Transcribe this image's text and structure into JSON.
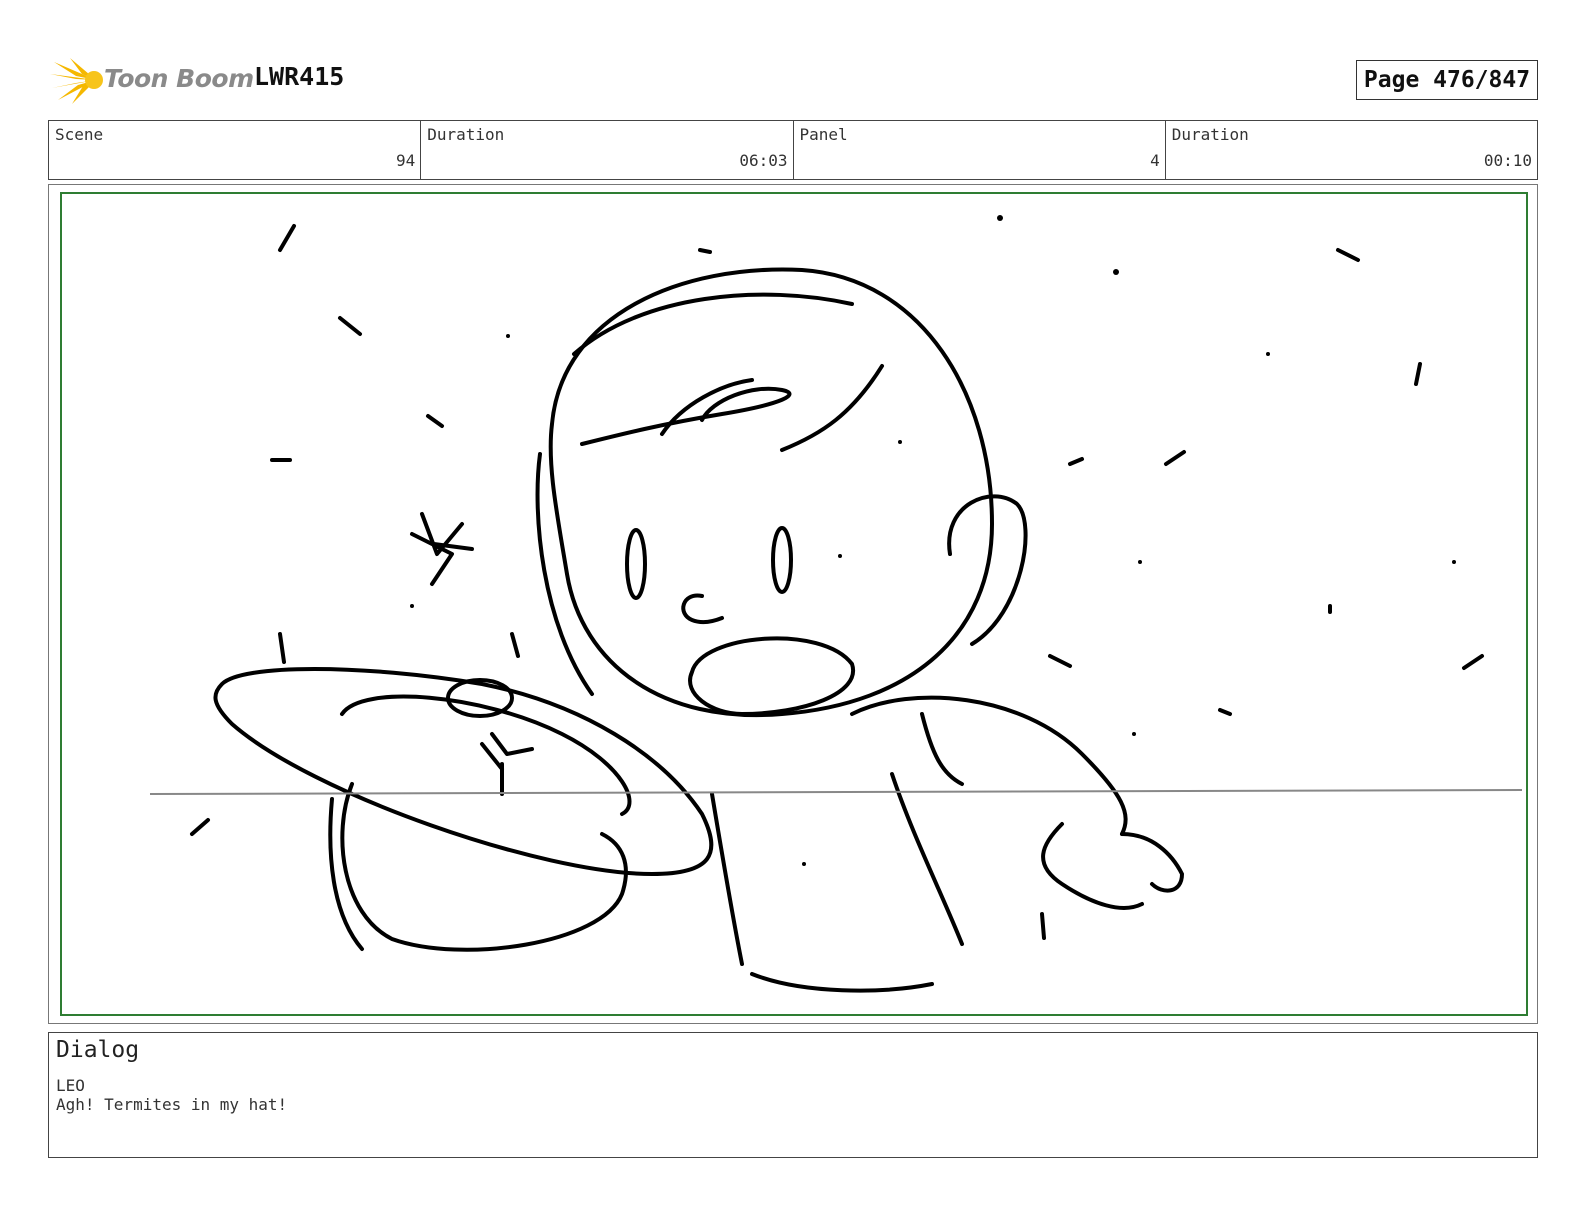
{
  "header": {
    "logo_text": "Toon Boom",
    "project_code": "LWR415",
    "page_label": "Page 476/847"
  },
  "info": [
    {
      "label": "Scene",
      "value": "94"
    },
    {
      "label": "Duration",
      "value": "06:03"
    },
    {
      "label": "Panel",
      "value": "4"
    },
    {
      "label": "Duration",
      "value": "00:10"
    }
  ],
  "panel": {
    "frame_color": "#2e7d32",
    "sketch_subject": "child startled by a flying termite swarm with a hat",
    "sketch_icon": "storyboard-sketch"
  },
  "dialog": {
    "heading": "Dialog",
    "character": "LEO",
    "line": "Agh! Termites in my hat!"
  },
  "colors": {
    "logo_star": "#f5b800",
    "logo_text": "#8a8a8a",
    "panel_border": "#2e7d32"
  }
}
